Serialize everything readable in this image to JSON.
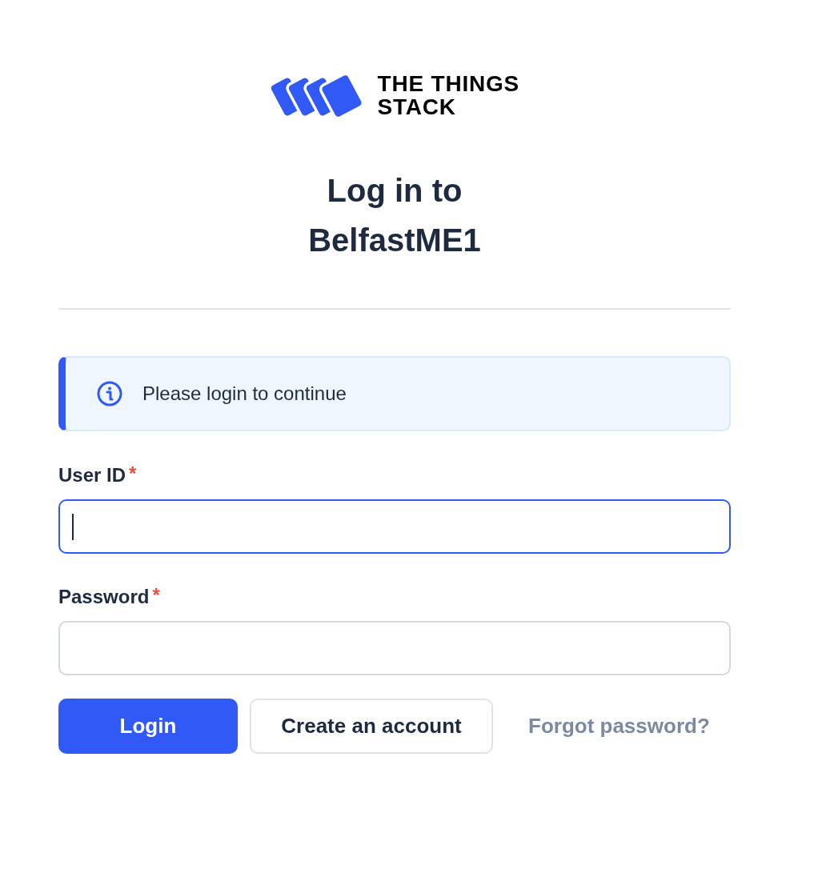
{
  "logo": {
    "wordmark": "THE THINGS STACK"
  },
  "heading": "Log in to BelfastME1",
  "notice": {
    "kind": "info",
    "text": "Please login to continue"
  },
  "fields": [
    {
      "label": "User ID",
      "required_mark": "*",
      "focused": true
    },
    {
      "label": "Password",
      "required_mark": "*",
      "focused": false
    }
  ],
  "actions": [
    {
      "kind": "primary",
      "label": "Login"
    },
    {
      "kind": "secondary",
      "label": "Create an account"
    },
    {
      "kind": "link",
      "label": "Forgot password?"
    }
  ]
}
